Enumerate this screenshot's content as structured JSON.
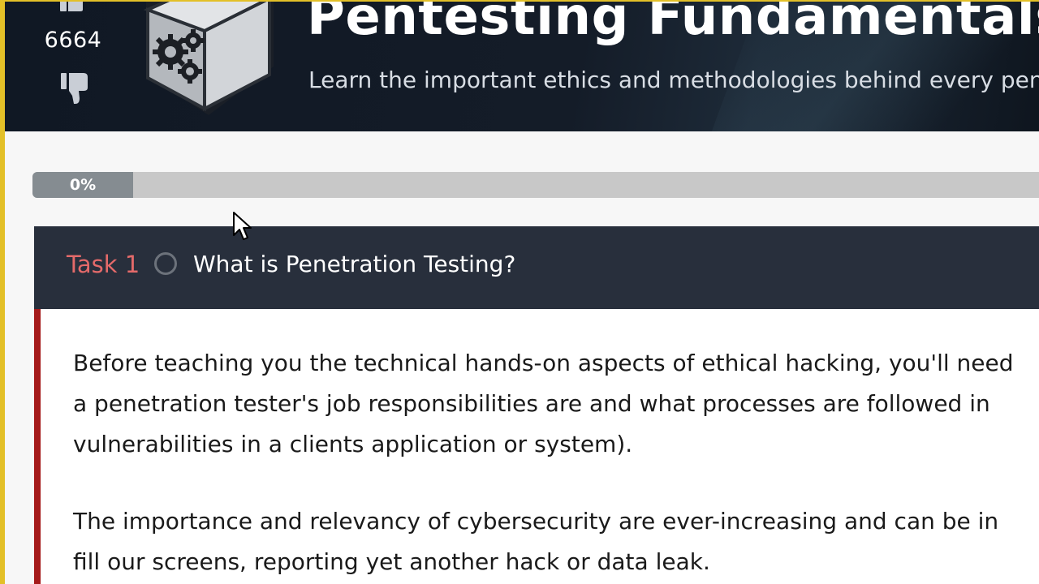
{
  "header": {
    "vote_count": "6664",
    "title": "Pentesting Fundamentals",
    "subtitle": "Learn the important ethics and methodologies behind every pentest."
  },
  "progress": {
    "label": "0%",
    "value": 0
  },
  "task": {
    "number_label": "Task 1",
    "title": "What is Penetration Testing?",
    "paragraphs": [
      {
        "lines": [
          "Before teaching you the technical hands-on aspects of ethical hacking, you'll need",
          "a penetration tester's job responsibilities are and what processes are followed in",
          "vulnerabilities in a clients application or system)."
        ]
      },
      {
        "lines": [
          "The importance and relevancy of cybersecurity are ever-increasing and can be in",
          "fill our screens, reporting yet another hack or data leak."
        ]
      }
    ]
  },
  "icons": {
    "upvote": "thumbs-up-icon",
    "downvote": "thumbs-down-icon",
    "room": "gears-box-icon",
    "task_status": "empty-circle-icon",
    "cursor": "mouse-pointer-icon"
  },
  "colors": {
    "header_bg": "#141c28",
    "task_number": "#e46a6a",
    "task_header_bg": "#282f3c",
    "task_border": "#a51a1a",
    "progress_fill": "#858c91",
    "progress_track": "#c8c8c8",
    "window_border": "#e3c028"
  }
}
